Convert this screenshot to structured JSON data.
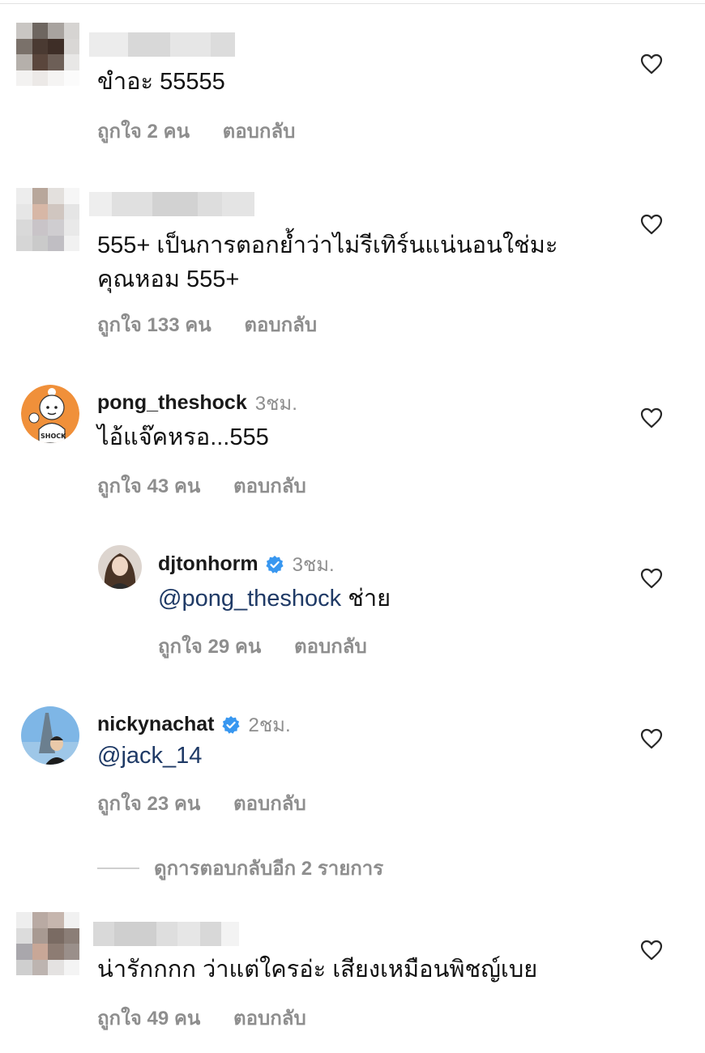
{
  "comments": [
    {
      "username": "",
      "time": "",
      "text": "ขำอะ 55555",
      "likes": "ถูกใจ 2 คน",
      "reply": "ตอบกลับ"
    },
    {
      "username": "",
      "time": "",
      "text": "555+ เป็นการตอกย้ำว่าไม่รีเทิร์นแน่นอนใช่มะ คุณหอม 555+",
      "likes": "ถูกใจ 133 คน",
      "reply": "ตอบกลับ"
    },
    {
      "username": "pong_theshock",
      "time": "3ชม.",
      "text": "ไอ้แจ๊คหรอ...555",
      "likes": "ถูกใจ 43 คน",
      "reply": "ตอบกลับ"
    },
    {
      "username": "djtonhorm",
      "time": "3ชม.",
      "verified": true,
      "mention": "@pong_theshock",
      "text": " ช่าย",
      "likes": "ถูกใจ 29 คน",
      "reply": "ตอบกลับ"
    },
    {
      "username": "nickynachat",
      "time": "2ชม.",
      "verified": true,
      "mention": "@jack_14",
      "text": "",
      "likes": "ถูกใจ 23 คน",
      "reply": "ตอบกลับ"
    },
    {
      "username": "",
      "time": "",
      "text": "น่ารักกกก ว่าแต่ใครอ่ะ เสียงเหมือนพิชญ์เบย",
      "likes": "ถูกใจ 49 คน",
      "reply": "ตอบกลับ"
    }
  ],
  "view_more_replies": "ดูการตอบกลับอีก 2 รายการ",
  "colors": {
    "mention": "#1f3a66",
    "muted": "#8e8e8e",
    "verified": "#3897f0"
  },
  "icons": {
    "like": "heart-outline-icon",
    "verified": "verified-badge-icon"
  }
}
